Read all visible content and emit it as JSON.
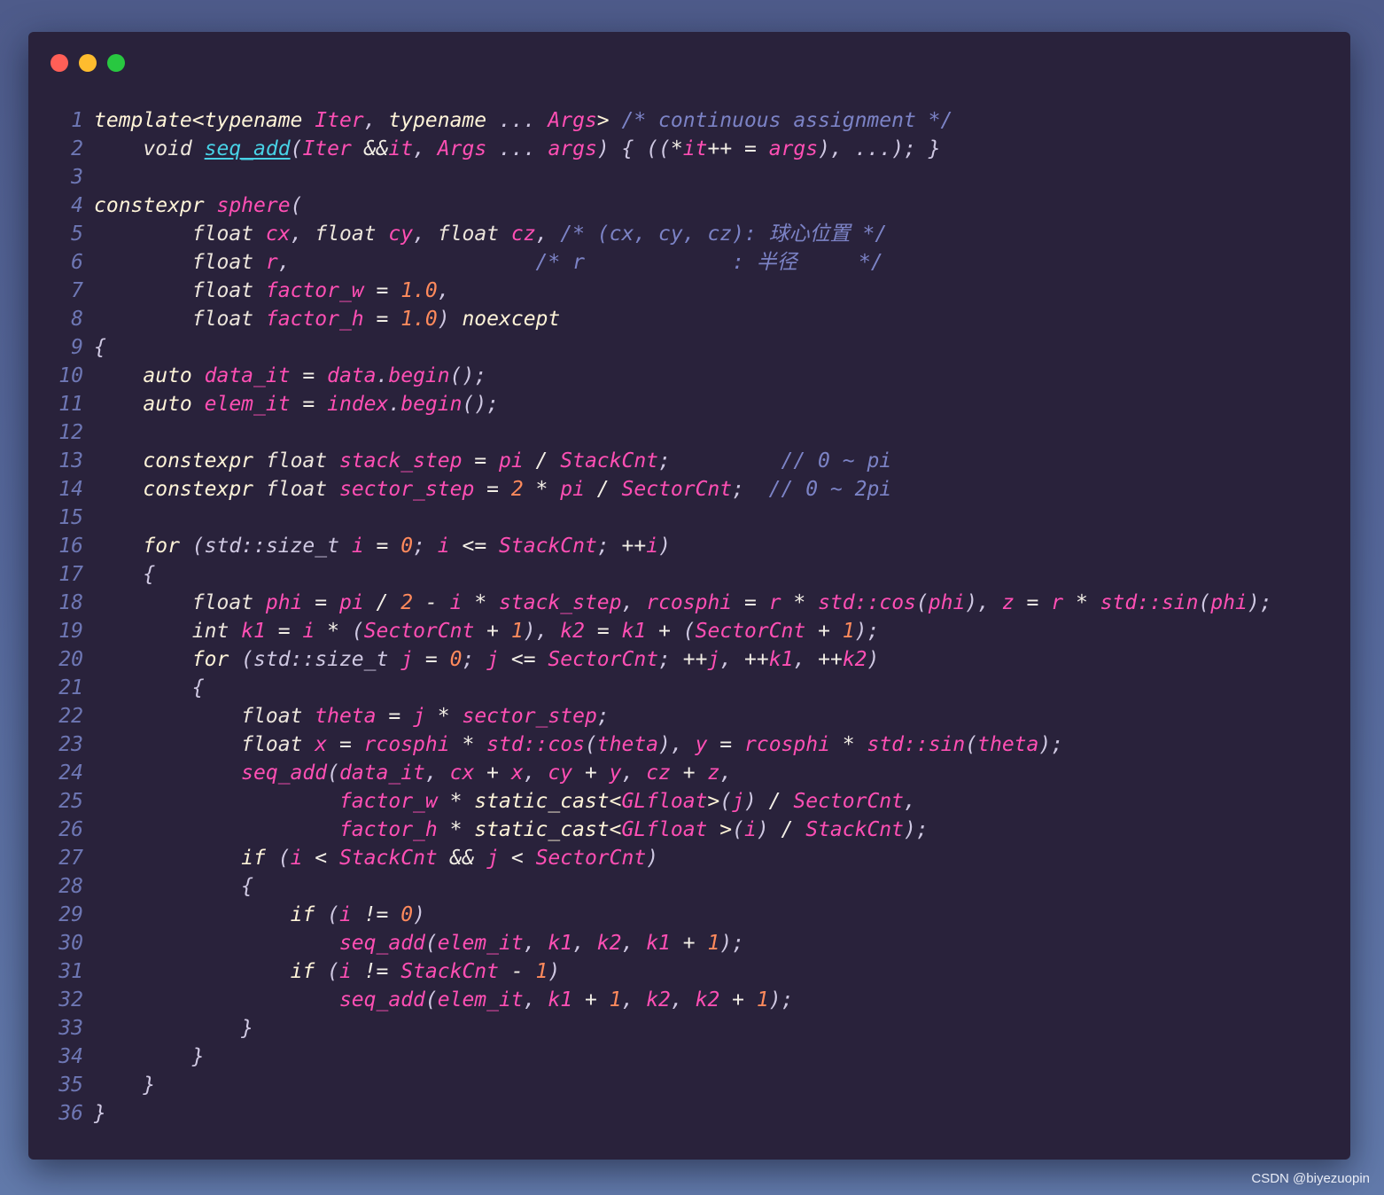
{
  "window": {
    "buttons": [
      "close",
      "minimize",
      "zoom"
    ]
  },
  "colors": {
    "background": "#29223b",
    "keyword": "#fff4d8",
    "variable": "#ff4fb4",
    "number": "#ff8a5c",
    "function": "#48d2e6",
    "comment": "#7c83c6",
    "line_number": "#6e77b4"
  },
  "code": {
    "lines": [
      [
        [
          "k",
          "template<typename "
        ],
        [
          "v",
          "Iter"
        ],
        [
          "p",
          ", "
        ],
        [
          "k",
          "typename"
        ],
        [
          "p",
          " ... "
        ],
        [
          "v",
          "Args"
        ],
        [
          "k",
          "> "
        ],
        [
          "c",
          "/* continuous assignment */"
        ]
      ],
      [
        [
          "p",
          "    "
        ],
        [
          "t",
          "void "
        ],
        [
          "fu",
          "seq_add"
        ],
        [
          "p",
          "("
        ],
        [
          "v",
          "Iter "
        ],
        [
          "o",
          "&&"
        ],
        [
          "v",
          "it"
        ],
        [
          "p",
          ", "
        ],
        [
          "v",
          "Args"
        ],
        [
          "p",
          " ... "
        ],
        [
          "v",
          "args"
        ],
        [
          "p",
          ") { (("
        ],
        [
          "o",
          "*"
        ],
        [
          "v",
          "it"
        ],
        [
          "o",
          "++ = "
        ],
        [
          "v",
          "args"
        ],
        [
          "p",
          "), ...); }"
        ]
      ],
      [],
      [
        [
          "k",
          "constexpr "
        ],
        [
          "v",
          "sphere"
        ],
        [
          "p",
          "("
        ]
      ],
      [
        [
          "p",
          "        "
        ],
        [
          "t",
          "float "
        ],
        [
          "v",
          "cx"
        ],
        [
          "p",
          ", "
        ],
        [
          "t",
          "float "
        ],
        [
          "v",
          "cy"
        ],
        [
          "p",
          ", "
        ],
        [
          "t",
          "float "
        ],
        [
          "v",
          "cz"
        ],
        [
          "p",
          ", "
        ],
        [
          "c",
          "/* (cx, cy, cz): 球心位置 */"
        ]
      ],
      [
        [
          "p",
          "        "
        ],
        [
          "t",
          "float "
        ],
        [
          "v",
          "r"
        ],
        [
          "p",
          ",                    "
        ],
        [
          "c",
          "/* r            : 半径     */"
        ]
      ],
      [
        [
          "p",
          "        "
        ],
        [
          "t",
          "float "
        ],
        [
          "v",
          "factor_w"
        ],
        [
          "o",
          " = "
        ],
        [
          "n",
          "1.0"
        ],
        [
          "p",
          ","
        ]
      ],
      [
        [
          "p",
          "        "
        ],
        [
          "t",
          "float "
        ],
        [
          "v",
          "factor_h"
        ],
        [
          "o",
          " = "
        ],
        [
          "n",
          "1.0"
        ],
        [
          "p",
          ") "
        ],
        [
          "k",
          "noexcept"
        ]
      ],
      [
        [
          "p",
          "{"
        ]
      ],
      [
        [
          "p",
          "    "
        ],
        [
          "k",
          "auto "
        ],
        [
          "v",
          "data_it"
        ],
        [
          "o",
          " = "
        ],
        [
          "v",
          "data"
        ],
        [
          "p",
          "."
        ],
        [
          "v",
          "begin"
        ],
        [
          "p",
          "();"
        ]
      ],
      [
        [
          "p",
          "    "
        ],
        [
          "k",
          "auto "
        ],
        [
          "v",
          "elem_it"
        ],
        [
          "o",
          " = "
        ],
        [
          "v",
          "index"
        ],
        [
          "p",
          "."
        ],
        [
          "v",
          "begin"
        ],
        [
          "p",
          "();"
        ]
      ],
      [],
      [
        [
          "p",
          "    "
        ],
        [
          "k",
          "constexpr "
        ],
        [
          "t",
          "float "
        ],
        [
          "v",
          "stack_step"
        ],
        [
          "o",
          " = "
        ],
        [
          "v",
          "pi"
        ],
        [
          "o",
          " / "
        ],
        [
          "v",
          "StackCnt"
        ],
        [
          "p",
          ";         "
        ],
        [
          "c",
          "// 0 ~ pi"
        ]
      ],
      [
        [
          "p",
          "    "
        ],
        [
          "k",
          "constexpr "
        ],
        [
          "t",
          "float "
        ],
        [
          "v",
          "sector_step"
        ],
        [
          "o",
          " = "
        ],
        [
          "n",
          "2"
        ],
        [
          "o",
          " * "
        ],
        [
          "v",
          "pi"
        ],
        [
          "o",
          " / "
        ],
        [
          "v",
          "SectorCnt"
        ],
        [
          "p",
          ";  "
        ],
        [
          "c",
          "// 0 ~ 2pi"
        ]
      ],
      [],
      [
        [
          "p",
          "    "
        ],
        [
          "k",
          "for"
        ],
        [
          "p",
          " (std::size_t "
        ],
        [
          "v",
          "i"
        ],
        [
          "o",
          " = "
        ],
        [
          "n",
          "0"
        ],
        [
          "p",
          "; "
        ],
        [
          "v",
          "i"
        ],
        [
          "o",
          " <= "
        ],
        [
          "v",
          "StackCnt"
        ],
        [
          "p",
          "; "
        ],
        [
          "o",
          "++"
        ],
        [
          "v",
          "i"
        ],
        [
          "p",
          ")"
        ]
      ],
      [
        [
          "p",
          "    {"
        ]
      ],
      [
        [
          "p",
          "        "
        ],
        [
          "t",
          "float "
        ],
        [
          "v",
          "phi"
        ],
        [
          "o",
          " = "
        ],
        [
          "v",
          "pi"
        ],
        [
          "o",
          " / "
        ],
        [
          "n",
          "2"
        ],
        [
          "o",
          " - "
        ],
        [
          "v",
          "i"
        ],
        [
          "o",
          " * "
        ],
        [
          "v",
          "stack_step"
        ],
        [
          "p",
          ", "
        ],
        [
          "v",
          "rcosphi"
        ],
        [
          "o",
          " = "
        ],
        [
          "v",
          "r"
        ],
        [
          "o",
          " * "
        ],
        [
          "v",
          "std::cos"
        ],
        [
          "p",
          "("
        ],
        [
          "v",
          "phi"
        ],
        [
          "p",
          "), "
        ],
        [
          "v",
          "z"
        ],
        [
          "o",
          " = "
        ],
        [
          "v",
          "r"
        ],
        [
          "o",
          " * "
        ],
        [
          "v",
          "std::sin"
        ],
        [
          "p",
          "("
        ],
        [
          "v",
          "phi"
        ],
        [
          "p",
          ");"
        ]
      ],
      [
        [
          "p",
          "        "
        ],
        [
          "t",
          "int "
        ],
        [
          "v",
          "k1"
        ],
        [
          "o",
          " = "
        ],
        [
          "v",
          "i"
        ],
        [
          "o",
          " * "
        ],
        [
          "p",
          "("
        ],
        [
          "v",
          "SectorCnt"
        ],
        [
          "o",
          " + "
        ],
        [
          "n",
          "1"
        ],
        [
          "p",
          "), "
        ],
        [
          "v",
          "k2"
        ],
        [
          "o",
          " = "
        ],
        [
          "v",
          "k1"
        ],
        [
          "o",
          " + "
        ],
        [
          "p",
          "("
        ],
        [
          "v",
          "SectorCnt"
        ],
        [
          "o",
          " + "
        ],
        [
          "n",
          "1"
        ],
        [
          "p",
          ");"
        ]
      ],
      [
        [
          "p",
          "        "
        ],
        [
          "k",
          "for"
        ],
        [
          "p",
          " (std::size_t "
        ],
        [
          "v",
          "j"
        ],
        [
          "o",
          " = "
        ],
        [
          "n",
          "0"
        ],
        [
          "p",
          "; "
        ],
        [
          "v",
          "j"
        ],
        [
          "o",
          " <= "
        ],
        [
          "v",
          "SectorCnt"
        ],
        [
          "p",
          "; "
        ],
        [
          "o",
          "++"
        ],
        [
          "v",
          "j"
        ],
        [
          "p",
          ", "
        ],
        [
          "o",
          "++"
        ],
        [
          "v",
          "k1"
        ],
        [
          "p",
          ", "
        ],
        [
          "o",
          "++"
        ],
        [
          "v",
          "k2"
        ],
        [
          "p",
          ")"
        ]
      ],
      [
        [
          "p",
          "        {"
        ]
      ],
      [
        [
          "p",
          "            "
        ],
        [
          "t",
          "float "
        ],
        [
          "v",
          "theta"
        ],
        [
          "o",
          " = "
        ],
        [
          "v",
          "j"
        ],
        [
          "o",
          " * "
        ],
        [
          "v",
          "sector_step"
        ],
        [
          "p",
          ";"
        ]
      ],
      [
        [
          "p",
          "            "
        ],
        [
          "t",
          "float "
        ],
        [
          "v",
          "x"
        ],
        [
          "o",
          " = "
        ],
        [
          "v",
          "rcosphi"
        ],
        [
          "o",
          " * "
        ],
        [
          "v",
          "std::cos"
        ],
        [
          "p",
          "("
        ],
        [
          "v",
          "theta"
        ],
        [
          "p",
          "), "
        ],
        [
          "v",
          "y"
        ],
        [
          "o",
          " = "
        ],
        [
          "v",
          "rcosphi"
        ],
        [
          "o",
          " * "
        ],
        [
          "v",
          "std::sin"
        ],
        [
          "p",
          "("
        ],
        [
          "v",
          "theta"
        ],
        [
          "p",
          ");"
        ]
      ],
      [
        [
          "p",
          "            "
        ],
        [
          "v",
          "seq_add"
        ],
        [
          "p",
          "("
        ],
        [
          "v",
          "data_it"
        ],
        [
          "p",
          ", "
        ],
        [
          "v",
          "cx"
        ],
        [
          "o",
          " + "
        ],
        [
          "v",
          "x"
        ],
        [
          "p",
          ", "
        ],
        [
          "v",
          "cy"
        ],
        [
          "o",
          " + "
        ],
        [
          "v",
          "y"
        ],
        [
          "p",
          ", "
        ],
        [
          "v",
          "cz"
        ],
        [
          "o",
          " + "
        ],
        [
          "v",
          "z"
        ],
        [
          "p",
          ","
        ]
      ],
      [
        [
          "p",
          "                    "
        ],
        [
          "v",
          "factor_w"
        ],
        [
          "o",
          " * "
        ],
        [
          "k",
          "static_cast<"
        ],
        [
          "v",
          "GLfloat"
        ],
        [
          "k",
          ">"
        ],
        [
          "p",
          "("
        ],
        [
          "v",
          "j"
        ],
        [
          "p",
          ")"
        ],
        [
          "o",
          " / "
        ],
        [
          "v",
          "SectorCnt"
        ],
        [
          "p",
          ","
        ]
      ],
      [
        [
          "p",
          "                    "
        ],
        [
          "v",
          "factor_h"
        ],
        [
          "o",
          " * "
        ],
        [
          "k",
          "static_cast<"
        ],
        [
          "v",
          "GLfloat"
        ],
        [
          "k",
          " >"
        ],
        [
          "p",
          "("
        ],
        [
          "v",
          "i"
        ],
        [
          "p",
          ")"
        ],
        [
          "o",
          " / "
        ],
        [
          "v",
          "StackCnt"
        ],
        [
          "p",
          ");"
        ]
      ],
      [
        [
          "p",
          "            "
        ],
        [
          "k",
          "if"
        ],
        [
          "p",
          " ("
        ],
        [
          "v",
          "i"
        ],
        [
          "o",
          " < "
        ],
        [
          "v",
          "StackCnt"
        ],
        [
          "o",
          " && "
        ],
        [
          "v",
          "j"
        ],
        [
          "o",
          " < "
        ],
        [
          "v",
          "SectorCnt"
        ],
        [
          "p",
          ")"
        ]
      ],
      [
        [
          "p",
          "            {"
        ]
      ],
      [
        [
          "p",
          "                "
        ],
        [
          "k",
          "if"
        ],
        [
          "p",
          " ("
        ],
        [
          "v",
          "i"
        ],
        [
          "o",
          " != "
        ],
        [
          "n",
          "0"
        ],
        [
          "p",
          ")"
        ]
      ],
      [
        [
          "p",
          "                    "
        ],
        [
          "v",
          "seq_add"
        ],
        [
          "p",
          "("
        ],
        [
          "v",
          "elem_it"
        ],
        [
          "p",
          ", "
        ],
        [
          "v",
          "k1"
        ],
        [
          "p",
          ", "
        ],
        [
          "v",
          "k2"
        ],
        [
          "p",
          ", "
        ],
        [
          "v",
          "k1"
        ],
        [
          "o",
          " + "
        ],
        [
          "n",
          "1"
        ],
        [
          "p",
          ");"
        ]
      ],
      [
        [
          "p",
          "                "
        ],
        [
          "k",
          "if"
        ],
        [
          "p",
          " ("
        ],
        [
          "v",
          "i"
        ],
        [
          "o",
          " != "
        ],
        [
          "v",
          "StackCnt"
        ],
        [
          "o",
          " - "
        ],
        [
          "n",
          "1"
        ],
        [
          "p",
          ")"
        ]
      ],
      [
        [
          "p",
          "                    "
        ],
        [
          "v",
          "seq_add"
        ],
        [
          "p",
          "("
        ],
        [
          "v",
          "elem_it"
        ],
        [
          "p",
          ", "
        ],
        [
          "v",
          "k1"
        ],
        [
          "o",
          " + "
        ],
        [
          "n",
          "1"
        ],
        [
          "p",
          ", "
        ],
        [
          "v",
          "k2"
        ],
        [
          "p",
          ", "
        ],
        [
          "v",
          "k2"
        ],
        [
          "o",
          " + "
        ],
        [
          "n",
          "1"
        ],
        [
          "p",
          ");"
        ]
      ],
      [
        [
          "p",
          "            }"
        ]
      ],
      [
        [
          "p",
          "        }"
        ]
      ],
      [
        [
          "p",
          "    }"
        ]
      ],
      [
        [
          "p",
          "}"
        ]
      ]
    ]
  },
  "watermark": "CSDN @biyezuopin"
}
